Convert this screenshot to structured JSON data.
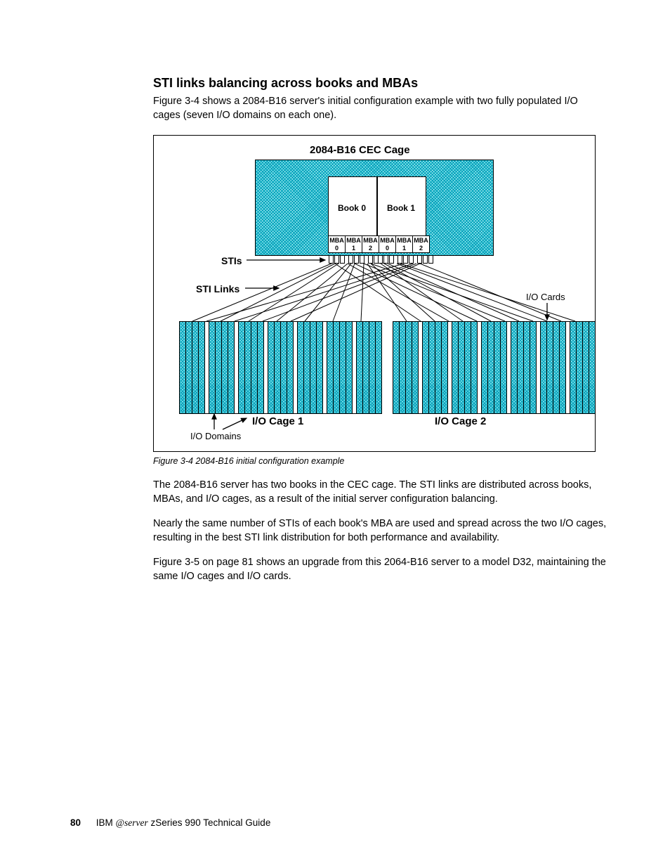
{
  "heading": "STI links balancing across books and MBAs",
  "intro": "Figure 3-4 shows a 2084-B16 server's initial configuration example with two fully populated I/O cages (seven I/O domains on each one).",
  "diagram": {
    "cec_title": "2084-B16  CEC Cage",
    "book0": "Book 0",
    "book1": "Book 1",
    "mba": "MBA",
    "mba_ids": [
      "0",
      "1",
      "2",
      "0",
      "1",
      "2"
    ],
    "stis": "STIs",
    "sti_links": "STI Links",
    "io_cards": "I/O Cards",
    "io_domains": "I/O Domains",
    "cage1": "I/O Cage 1",
    "cage2": "I/O Cage 2"
  },
  "caption": "Figure 3-4   2084-B16 initial configuration example",
  "para1": "The 2084-B16 server has two books in the CEC cage. The STI links are distributed across books, MBAs, and I/O cages, as a result of the initial server configuration balancing.",
  "para2": "Nearly the same number of STIs of each book's MBA are used and spread across the two I/O cages, resulting in the best STI link distribution for both performance and availability.",
  "para3": "Figure 3-5 on page 81 shows an upgrade from this 2064-B16 server to a model D32, maintaining the same I/O cages and I/O cards.",
  "footer": {
    "page": "80",
    "pub": "IBM ",
    "brand": "@server",
    "tail": " zSeries 990 Technical Guide"
  }
}
